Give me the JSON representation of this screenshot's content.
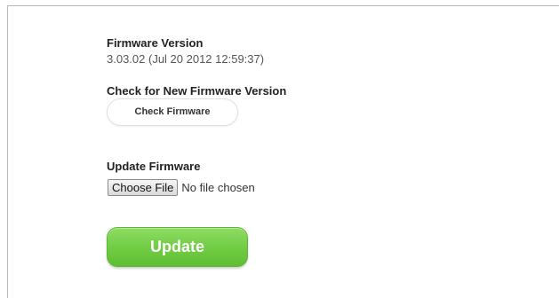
{
  "firmware": {
    "version_label": "Firmware Version",
    "version_value": "3.03.02 (Jul 20 2012 12:59:37)"
  },
  "check": {
    "title": "Check for New Firmware Version",
    "button_label": "Check Firmware"
  },
  "update": {
    "title": "Update Firmware",
    "choose_file_label": "Choose File",
    "file_status": "No file chosen",
    "button_label": "Update"
  },
  "colors": {
    "update_button": "#6fcb45",
    "border": "#b8b8b8"
  }
}
